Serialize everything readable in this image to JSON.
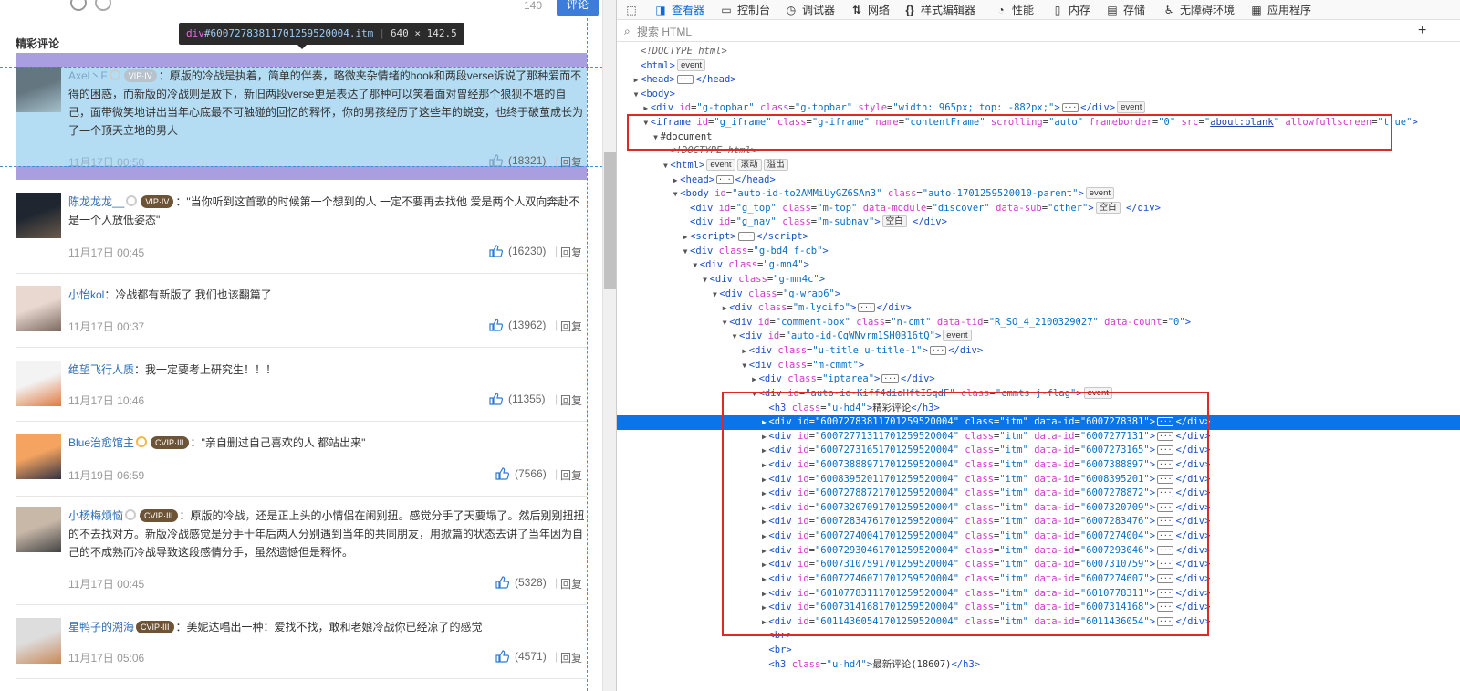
{
  "left": {
    "char_count": "140",
    "comment_button": "评论",
    "section_title": "精彩评论",
    "tooltip": {
      "tag": "div",
      "id": "#6007278381170125952000​4.itm",
      "size": "640 × 142.5"
    },
    "comments": [
      {
        "user": "Axel丶F",
        "badge": "VIP·IV",
        "text": "原版的冷战是执着，简单的伴奏，略微夹杂情绪的hook和两段verse诉说了那种爱而不得的困惑，而新版的冷战则是放下，新旧两段verse更是表达了那种可以笑着面对曾经那个狼狈不堪的自己，面带微笑地讲出当年心底最不可触碰的回忆的释怀，你的男孩经历了这些年的蜕变，也终于破茧成长为了一个顶天立地的男人",
        "time": "11月17日 00:50",
        "likes": "(18321)",
        "reply": "回复"
      },
      {
        "user": "陈龙龙龙__",
        "badge": "VIP·IV",
        "text": "\"当你听到这首歌的时候第一个想到的人 一定不要再去找他 爱是两个人双向奔赴不是一个人放低姿态\"",
        "time": "11月17日 00:45",
        "likes": "(16230)",
        "reply": "回复"
      },
      {
        "user": "小怡kol",
        "badge": "",
        "text": "冷战都有新版了 我们也该翻篇了",
        "time": "11月17日 00:37",
        "likes": "(13962)",
        "reply": "回复"
      },
      {
        "user": "绝望飞行人质",
        "badge": "",
        "text": "我一定要考上研究生！！！",
        "time": "11月17日 10:46",
        "likes": "(11355)",
        "reply": "回复"
      },
      {
        "user": "Blue治愈馆主",
        "badge": "CVIP·III",
        "text": "\"亲自删过自己喜欢的人 都站出来\"",
        "time": "11月19日 06:59",
        "likes": "(7566)",
        "reply": "回复"
      },
      {
        "user": "小杨梅烦恼",
        "badge": "CVIP·III",
        "text": "原版的冷战，还是正上头的小情侣在闹别扭。感觉分手了天要塌了。然后别别扭扭的不去找对方。新版冷战感觉是分手十年后两人分别遇到当年的共同朋友，用掀篇的状态去讲了当年因为自己的不成熟而冷战导致这段感情分手，虽然遗憾但是释怀。",
        "time": "11月17日 00:45",
        "likes": "(5328)",
        "reply": "回复"
      },
      {
        "user": "星鸭子的溯海",
        "badge": "CVIP·III",
        "text": "美妮达唱出一种：爱找不找，敢和老娘冷战你已经凉了的感觉",
        "time": "11月17日 05:06",
        "likes": "(4571)",
        "reply": "回复"
      }
    ]
  },
  "devtools": {
    "tabs": [
      {
        "icon": "picker-icon",
        "label": ""
      },
      {
        "icon": "inspector-icon",
        "label": "查看器"
      },
      {
        "icon": "console-icon",
        "label": "控制台"
      },
      {
        "icon": "debugger-icon",
        "label": "调试器"
      },
      {
        "icon": "network-icon",
        "label": "网络"
      },
      {
        "icon": "style-editor-icon",
        "label": "样式编辑器"
      },
      {
        "icon": "performance-icon",
        "label": "性能"
      },
      {
        "icon": "memory-icon",
        "label": "内存"
      },
      {
        "icon": "storage-icon",
        "label": "存储"
      },
      {
        "icon": "accessibility-icon",
        "label": "无障碍环境"
      },
      {
        "icon": "application-icon",
        "label": "应用程序"
      }
    ],
    "search_placeholder": "搜索 HTML",
    "tree_lines": [
      {
        "indent": 0,
        "tw": "",
        "html": "<span class='cm'>&lt;!DOCTYPE html&gt;</span>"
      },
      {
        "indent": 0,
        "tw": "",
        "html": "<span class='tg'>&lt;html&gt;</span><span class='badge'>event</span>"
      },
      {
        "indent": 0,
        "tw": "▶",
        "html": "<span class='tg'>&lt;head&gt;</span><span class='ell'>···</span><span class='tg'>&lt;/head&gt;</span>"
      },
      {
        "indent": 0,
        "tw": "▼",
        "html": "<span class='tg'>&lt;body&gt;</span>"
      },
      {
        "indent": 1,
        "tw": "▶",
        "html": "<span class='tg'>&lt;div </span><span class='an'>id</span>=<span class='av'>\"g-topbar\"</span> <span class='an'>class</span>=<span class='av'>\"g-topbar\"</span> <span class='an'>style</span>=<span class='av'>\"width: 965px; top: -882px;\"</span><span class='tg'>&gt;</span><span class='ell'>···</span><span class='tg'>&lt;/div&gt;</span><span class='badge'>event</span>"
      },
      {
        "indent": 1,
        "tw": "▼",
        "html": "<span class='tg'>&lt;iframe </span><span class='an'>id</span>=<span class='av'>\"g_iframe\"</span> <span class='an'>class</span>=<span class='av'>\"g-iframe\"</span> <span class='an'>name</span>=<span class='av'>\"contentFrame\"</span> <span class='an'>scrolling</span>=<span class='av'>\"auto\"</span> <span class='an'>frameborder</span>=<span class='av'>\"0\"</span> <span class='an'>src</span>=<span class='av'>\"</span><span class='av link'>about:blank</span><span class='av'>\"</span> <span class='an'>allowfullscreen</span>=<span class='av'>\"true\"</span><span class='tg'>&gt;</span>"
      },
      {
        "indent": 2,
        "tw": "▼",
        "html": "<span class='tx'>#document</span>"
      },
      {
        "indent": 3,
        "tw": "",
        "html": "<span class='cm'>&lt;!DOCTYPE html&gt;</span>"
      },
      {
        "indent": 3,
        "tw": "▼",
        "html": "<span class='tg'>&lt;html&gt;</span><span class='badge'>event</span><span class='badge'>滚动</span><span class='badge'>溢出</span>"
      },
      {
        "indent": 4,
        "tw": "▶",
        "html": "<span class='tg'>&lt;head&gt;</span><span class='ell'>···</span><span class='tg'>&lt;/head&gt;</span>"
      },
      {
        "indent": 4,
        "tw": "▼",
        "html": "<span class='tg'>&lt;body </span><span class='an'>id</span>=<span class='av'>\"auto-id-to2AMMiUyGZ6SAn3\"</span> <span class='an'>class</span>=<span class='av'>\"auto-1701259520010-parent\"</span><span class='tg'>&gt;</span><span class='badge'>event</span>"
      },
      {
        "indent": 5,
        "tw": "",
        "html": "<span class='tg'>&lt;div </span><span class='an'>id</span>=<span class='av'>\"g_top\"</span> <span class='an'>class</span>=<span class='av'>\"m-top\"</span> <span class='an'>data-module</span>=<span class='av'>\"discover\"</span> <span class='an'>data-sub</span>=<span class='av'>\"other\"</span><span class='tg'>&gt;</span><span class='badge'>空白</span> <span class='tg'>&lt;/div&gt;</span>"
      },
      {
        "indent": 5,
        "tw": "",
        "html": "<span class='tg'>&lt;div </span><span class='an'>id</span>=<span class='av'>\"g_nav\"</span> <span class='an'>class</span>=<span class='av'>\"m-subnav\"</span><span class='tg'>&gt;</span><span class='badge'>空白</span> <span class='tg'>&lt;/div&gt;</span>"
      },
      {
        "indent": 5,
        "tw": "▶",
        "html": "<span class='tg'>&lt;script&gt;</span><span class='ell'>···</span><span class='tg'>&lt;/script&gt;</span>"
      },
      {
        "indent": 5,
        "tw": "▼",
        "html": "<span class='tg'>&lt;div </span><span class='an'>class</span>=<span class='av'>\"g-bd4 f-cb\"</span><span class='tg'>&gt;</span>"
      },
      {
        "indent": 6,
        "tw": "▼",
        "html": "<span class='tg'>&lt;div </span><span class='an'>class</span>=<span class='av'>\"g-mn4\"</span><span class='tg'>&gt;</span>"
      },
      {
        "indent": 7,
        "tw": "▼",
        "html": "<span class='tg'>&lt;div </span><span class='an'>class</span>=<span class='av'>\"g-mn4c\"</span><span class='tg'>&gt;</span>"
      },
      {
        "indent": 8,
        "tw": "▼",
        "html": "<span class='tg'>&lt;div </span><span class='an'>class</span>=<span class='av'>\"g-wrap6\"</span><span class='tg'>&gt;</span>"
      },
      {
        "indent": 9,
        "tw": "▶",
        "html": "<span class='tg'>&lt;div </span><span class='an'>class</span>=<span class='av'>\"m-lycifo\"</span><span class='tg'>&gt;</span><span class='ell'>···</span><span class='tg'>&lt;/div&gt;</span>"
      },
      {
        "indent": 9,
        "tw": "▼",
        "html": "<span class='tg'>&lt;div </span><span class='an'>id</span>=<span class='av'>\"comment-box\"</span> <span class='an'>class</span>=<span class='av'>\"n-cmt\"</span> <span class='an'>data-tid</span>=<span class='av'>\"R_SO_4_2100329027\"</span> <span class='an'>data-count</span>=<span class='av'>\"0\"</span><span class='tg'>&gt;</span>"
      },
      {
        "indent": 10,
        "tw": "▼",
        "html": "<span class='tg'>&lt;div </span><span class='an'>id</span>=<span class='av'>\"auto-id-CgWNvrm1SH0B16tQ\"</span><span class='tg'>&gt;</span><span class='badge'>event</span>"
      },
      {
        "indent": 11,
        "tw": "▶",
        "html": "<span class='tg'>&lt;div </span><span class='an'>class</span>=<span class='av'>\"u-title u-title-1\"</span><span class='tg'>&gt;</span><span class='ell'>···</span><span class='tg'>&lt;/div&gt;</span>"
      },
      {
        "indent": 11,
        "tw": "▼",
        "html": "<span class='tg'>&lt;div </span><span class='an'>class</span>=<span class='av'>\"m-cmmt\"</span><span class='tg'>&gt;</span>"
      },
      {
        "indent": 12,
        "tw": "▶",
        "html": "<span class='tg'>&lt;div </span><span class='an'>class</span>=<span class='av'>\"iptarea\"</span><span class='tg'>&gt;</span><span class='ell'>···</span><span class='tg'>&lt;/div&gt;</span>"
      },
      {
        "indent": 12,
        "tw": "▼",
        "html": "<span class='tg'>&lt;div </span><span class='an'>id</span>=<span class='av'>\"auto-id-Kiff4diaHftISqdF\"</span> <span class='an'>class</span>=<span class='av'>\"cmmts j-flag\"</span><span class='tg'>&gt;</span><span class='badge'>event</span>"
      },
      {
        "indent": 13,
        "tw": "",
        "html": "<span class='tg'>&lt;h3 </span><span class='an'>class</span>=<span class='av'>\"u-hd4\"</span><span class='tg'>&gt;</span><span class='tx'>精彩评论</span><span class='tg'>&lt;/h3&gt;</span>"
      },
      {
        "indent": 13,
        "tw": "▶",
        "sel": true,
        "html": "<span class='tg'>&lt;div </span><span class='an'>id</span>=<span class='av'>\"600727838117012595200​04\"</span> <span class='an'>class</span>=<span class='av'>\"itm\"</span> <span class='an'>data-id</span>=<span class='av'>\"6007278381\"</span><span class='tg'>&gt;</span><span class='ell'>···</span><span class='tg'>&lt;/div&gt;</span>"
      },
      {
        "indent": 13,
        "tw": "▶",
        "html": "<span class='tg'>&lt;div </span><span class='an'>id</span>=<span class='av'>\"600727713117012595200​04\"</span> <span class='an'>class</span>=<span class='av'>\"itm\"</span> <span class='an'>data-id</span>=<span class='av'>\"6007277131\"</span><span class='tg'>&gt;</span><span class='ell'>···</span><span class='tg'>&lt;/div&gt;</span>"
      },
      {
        "indent": 13,
        "tw": "▶",
        "html": "<span class='tg'>&lt;div </span><span class='an'>id</span>=<span class='av'>\"600727316517012595200​04\"</span> <span class='an'>class</span>=<span class='av'>\"itm\"</span> <span class='an'>data-id</span>=<span class='av'>\"6007273165\"</span><span class='tg'>&gt;</span><span class='ell'>···</span><span class='tg'>&lt;/div&gt;</span>"
      },
      {
        "indent": 13,
        "tw": "▶",
        "html": "<span class='tg'>&lt;div </span><span class='an'>id</span>=<span class='av'>\"600738889717012595200​04\"</span> <span class='an'>class</span>=<span class='av'>\"itm\"</span> <span class='an'>data-id</span>=<span class='av'>\"6007388897\"</span><span class='tg'>&gt;</span><span class='ell'>···</span><span class='tg'>&lt;/div&gt;</span>"
      },
      {
        "indent": 13,
        "tw": "▶",
        "html": "<span class='tg'>&lt;div </span><span class='an'>id</span>=<span class='av'>\"600839520117012595200​04\"</span> <span class='an'>class</span>=<span class='av'>\"itm\"</span> <span class='an'>data-id</span>=<span class='av'>\"6008395201\"</span><span class='tg'>&gt;</span><span class='ell'>···</span><span class='tg'>&lt;/div&gt;</span>"
      },
      {
        "indent": 13,
        "tw": "▶",
        "html": "<span class='tg'>&lt;div </span><span class='an'>id</span>=<span class='av'>\"600727887217012595200​04\"</span> <span class='an'>class</span>=<span class='av'>\"itm\"</span> <span class='an'>data-id</span>=<span class='av'>\"6007278872\"</span><span class='tg'>&gt;</span><span class='ell'>···</span><span class='tg'>&lt;/div&gt;</span>"
      },
      {
        "indent": 13,
        "tw": "▶",
        "html": "<span class='tg'>&lt;div </span><span class='an'>id</span>=<span class='av'>\"600732070917012595200​04\"</span> <span class='an'>class</span>=<span class='av'>\"itm\"</span> <span class='an'>data-id</span>=<span class='av'>\"6007320709\"</span><span class='tg'>&gt;</span><span class='ell'>···</span><span class='tg'>&lt;/div&gt;</span>"
      },
      {
        "indent": 13,
        "tw": "▶",
        "html": "<span class='tg'>&lt;div </span><span class='an'>id</span>=<span class='av'>\"600728347617012595200​04\"</span> <span class='an'>class</span>=<span class='av'>\"itm\"</span> <span class='an'>data-id</span>=<span class='av'>\"6007283476\"</span><span class='tg'>&gt;</span><span class='ell'>···</span><span class='tg'>&lt;/div&gt;</span>"
      },
      {
        "indent": 13,
        "tw": "▶",
        "html": "<span class='tg'>&lt;div </span><span class='an'>id</span>=<span class='av'>\"600727400417012595200​04\"</span> <span class='an'>class</span>=<span class='av'>\"itm\"</span> <span class='an'>data-id</span>=<span class='av'>\"6007274004\"</span><span class='tg'>&gt;</span><span class='ell'>···</span><span class='tg'>&lt;/div&gt;</span>"
      },
      {
        "indent": 13,
        "tw": "▶",
        "html": "<span class='tg'>&lt;div </span><span class='an'>id</span>=<span class='av'>\"600729304617012595200​04\"</span> <span class='an'>class</span>=<span class='av'>\"itm\"</span> <span class='an'>data-id</span>=<span class='av'>\"6007293046\"</span><span class='tg'>&gt;</span><span class='ell'>···</span><span class='tg'>&lt;/div&gt;</span>"
      },
      {
        "indent": 13,
        "tw": "▶",
        "html": "<span class='tg'>&lt;div </span><span class='an'>id</span>=<span class='av'>\"600731075917012595200​04\"</span> <span class='an'>class</span>=<span class='av'>\"itm\"</span> <span class='an'>data-id</span>=<span class='av'>\"6007310759\"</span><span class='tg'>&gt;</span><span class='ell'>···</span><span class='tg'>&lt;/div&gt;</span>"
      },
      {
        "indent": 13,
        "tw": "▶",
        "html": "<span class='tg'>&lt;div </span><span class='an'>id</span>=<span class='av'>\"600727460717012595200​04\"</span> <span class='an'>class</span>=<span class='av'>\"itm\"</span> <span class='an'>data-id</span>=<span class='av'>\"6007274607\"</span><span class='tg'>&gt;</span><span class='ell'>···</span><span class='tg'>&lt;/div&gt;</span>"
      },
      {
        "indent": 13,
        "tw": "▶",
        "html": "<span class='tg'>&lt;div </span><span class='an'>id</span>=<span class='av'>\"601077831117012595200​04\"</span> <span class='an'>class</span>=<span class='av'>\"itm\"</span> <span class='an'>data-id</span>=<span class='av'>\"6010778311\"</span><span class='tg'>&gt;</span><span class='ell'>···</span><span class='tg'>&lt;/div&gt;</span>"
      },
      {
        "indent": 13,
        "tw": "▶",
        "html": "<span class='tg'>&lt;div </span><span class='an'>id</span>=<span class='av'>\"600731416817012595200​04\"</span> <span class='an'>class</span>=<span class='av'>\"itm\"</span> <span class='an'>data-id</span>=<span class='av'>\"6007314168\"</span><span class='tg'>&gt;</span><span class='ell'>···</span><span class='tg'>&lt;/div&gt;</span>"
      },
      {
        "indent": 13,
        "tw": "▶",
        "html": "<span class='tg'>&lt;div </span><span class='an'>id</span>=<span class='av'>\"601143605417012595200​04\"</span> <span class='an'>class</span>=<span class='av'>\"itm\"</span> <span class='an'>data-id</span>=<span class='av'>\"6011436054\"</span><span class='tg'>&gt;</span><span class='ell'>···</span><span class='tg'>&lt;/div&gt;</span>"
      },
      {
        "indent": 13,
        "tw": "",
        "html": "<span class='tg'>&lt;br&gt;</span>"
      },
      {
        "indent": 13,
        "tw": "",
        "html": "<span class='tg'>&lt;br&gt;</span>"
      },
      {
        "indent": 13,
        "tw": "",
        "html": "<span class='tg'>&lt;h3 </span><span class='an'>class</span>=<span class='av'>\"u-hd4\"</span><span class='tg'>&gt;</span><span class='tx'>最新评论(18607)</span><span class='tg'>&lt;/h3&gt;</span>"
      }
    ]
  }
}
